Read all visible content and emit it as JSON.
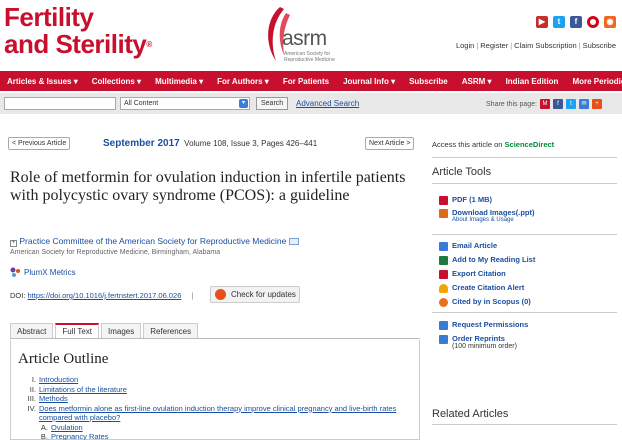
{
  "brand": {
    "line1": "Fertility",
    "line2": "and Sterility",
    "mark": "®"
  },
  "asrm": {
    "word": "asrm",
    "sub1": "American Society for",
    "sub2": "Reproductive Medicine"
  },
  "social_icons": [
    "youtube-icon",
    "twitter-icon",
    "facebook-icon",
    "pinterest-icon",
    "rss-icon"
  ],
  "top_links": [
    "Login",
    "Register",
    "Claim Subscription",
    "Subscribe"
  ],
  "nav": [
    "Articles & Issues ▾",
    "Collections ▾",
    "Multimedia ▾",
    "For Authors ▾",
    "For Patients",
    "Journal Info ▾",
    "Subscribe",
    "ASRM ▾",
    "Indian Edition",
    "More Periodicals ▾"
  ],
  "search": {
    "select_value": "All Content",
    "button": "Search",
    "advanced": "Advanced Search",
    "share_label": "Share this page:"
  },
  "article_nav": {
    "prev": "< Previous Article",
    "issue_month": "September 2017",
    "issue_detail": "Volume 108, Issue 3, Pages 426–441",
    "next": "Next Article >"
  },
  "article": {
    "title": "Role of metformin for ovulation induction in infertile patients with polycystic ovary syndrome (PCOS): a guideline",
    "authors": "Practice Committee of the American Society for Reproductive Medicine",
    "affiliation": "American Society for Reproductive Medicine, Birmingham, Alabama",
    "plumx": "PlumX Metrics",
    "doi_label": "DOI:",
    "doi": "https://doi.org/10.1016/j.fertnstert.2017.06.026",
    "doi_sep": "|",
    "check_updates": "Check for updates"
  },
  "tabs": [
    "Abstract",
    "Full Text",
    "Images",
    "References"
  ],
  "outline": {
    "title": "Article Outline",
    "items": [
      {
        "num": "I.",
        "text": "Introduction"
      },
      {
        "num": "II.",
        "text": "Limitations of the literature"
      },
      {
        "num": "III.",
        "text": "Methods"
      },
      {
        "num": "IV.",
        "text": "Does metformin alone as first-line ovulation induction therapy improve clinical pregnancy and live-birth rates compared with placebo?"
      },
      {
        "num": "A.",
        "text": "Ovulation",
        "sub": true
      },
      {
        "num": "B.",
        "text": "Pregnancy Rates",
        "sub": true
      }
    ]
  },
  "sidebar": {
    "access_prefix": "Access this article on",
    "access_link": "ScienceDirect",
    "tools_title": "Article Tools",
    "pdf": "PDF (1 MB)",
    "images": "Download Images(.ppt)",
    "images_sub": "About Images & Usage",
    "email": "Email Article",
    "reading": "Add to My Reading List",
    "export": "Export Citation",
    "alert": "Create Citation Alert",
    "cited": "Cited by in Scopus (0)",
    "permissions": "Request Permissions",
    "reprints": "Order Reprints",
    "reprints_sub": "(100 minimum order)",
    "related_title": "Related Articles"
  }
}
